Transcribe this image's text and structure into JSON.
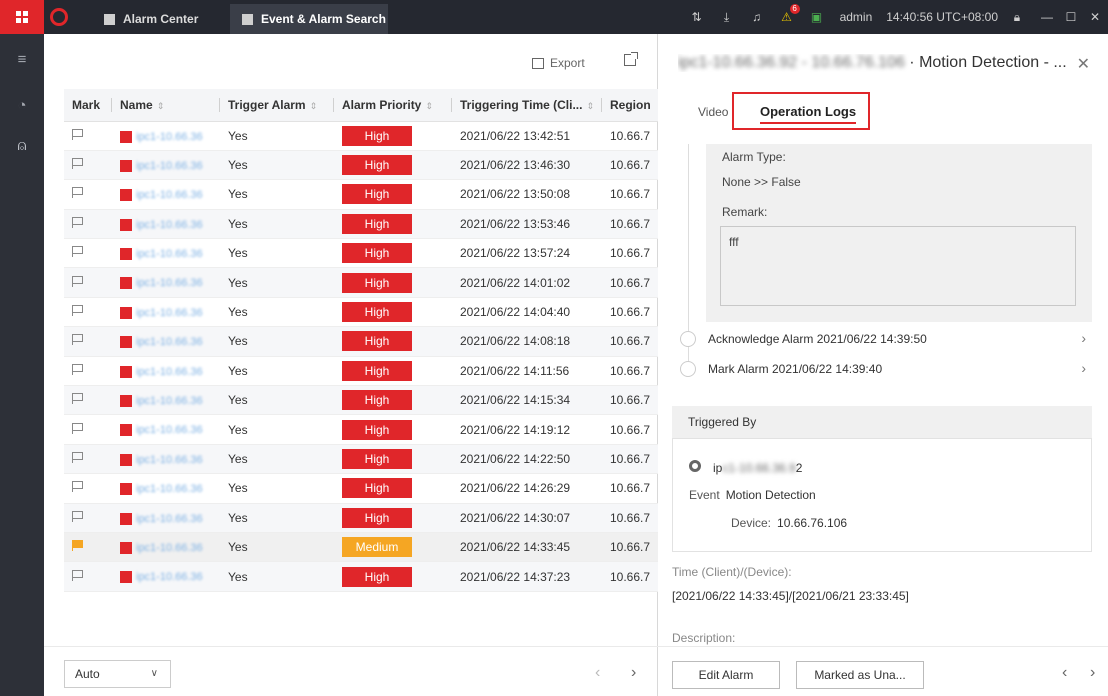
{
  "titlebar": {
    "tabs": [
      {
        "label": "Alarm Center",
        "icon": "alarm-center-icon"
      },
      {
        "label": "Event & Alarm Search",
        "icon": "event-search-icon"
      }
    ],
    "notification_count": "6",
    "user": "admin",
    "clock": "14:40:56 UTC+08:00"
  },
  "toolbar": {
    "export_label": "Export"
  },
  "table": {
    "columns": [
      "Mark",
      "Name",
      "Trigger Alarm",
      "Alarm Priority",
      "Triggering Time (Cli...",
      "Region"
    ],
    "rows": [
      {
        "marked": false,
        "name": "ipc1-10.66.36",
        "trigger": "Yes",
        "priority": "High",
        "time": "2021/06/22 13:42:51",
        "region": "10.66.7"
      },
      {
        "marked": false,
        "name": "ipc1-10.66.36",
        "trigger": "Yes",
        "priority": "High",
        "time": "2021/06/22 13:46:30",
        "region": "10.66.7"
      },
      {
        "marked": false,
        "name": "ipc1-10.66.36",
        "trigger": "Yes",
        "priority": "High",
        "time": "2021/06/22 13:50:08",
        "region": "10.66.7"
      },
      {
        "marked": false,
        "name": "ipc1-10.66.36",
        "trigger": "Yes",
        "priority": "High",
        "time": "2021/06/22 13:53:46",
        "region": "10.66.7"
      },
      {
        "marked": false,
        "name": "ipc1-10.66.36",
        "trigger": "Yes",
        "priority": "High",
        "time": "2021/06/22 13:57:24",
        "region": "10.66.7"
      },
      {
        "marked": false,
        "name": "ipc1-10.66.36",
        "trigger": "Yes",
        "priority": "High",
        "time": "2021/06/22 14:01:02",
        "region": "10.66.7"
      },
      {
        "marked": false,
        "name": "ipc1-10.66.36",
        "trigger": "Yes",
        "priority": "High",
        "time": "2021/06/22 14:04:40",
        "region": "10.66.7"
      },
      {
        "marked": false,
        "name": "ipc1-10.66.36",
        "trigger": "Yes",
        "priority": "High",
        "time": "2021/06/22 14:08:18",
        "region": "10.66.7"
      },
      {
        "marked": false,
        "name": "ipc1-10.66.36",
        "trigger": "Yes",
        "priority": "High",
        "time": "2021/06/22 14:11:56",
        "region": "10.66.7"
      },
      {
        "marked": false,
        "name": "ipc1-10.66.36",
        "trigger": "Yes",
        "priority": "High",
        "time": "2021/06/22 14:15:34",
        "region": "10.66.7"
      },
      {
        "marked": false,
        "name": "ipc1-10.66.36",
        "trigger": "Yes",
        "priority": "High",
        "time": "2021/06/22 14:19:12",
        "region": "10.66.7"
      },
      {
        "marked": false,
        "name": "ipc1-10.66.36",
        "trigger": "Yes",
        "priority": "High",
        "time": "2021/06/22 14:22:50",
        "region": "10.66.7"
      },
      {
        "marked": false,
        "name": "ipc1-10.66.36",
        "trigger": "Yes",
        "priority": "High",
        "time": "2021/06/22 14:26:29",
        "region": "10.66.7"
      },
      {
        "marked": false,
        "name": "ipc1-10.66.36",
        "trigger": "Yes",
        "priority": "High",
        "time": "2021/06/22 14:30:07",
        "region": "10.66.7"
      },
      {
        "marked": true,
        "name": "ipc1-10.66.36",
        "trigger": "Yes",
        "priority": "Medium",
        "time": "2021/06/22 14:33:45",
        "region": "10.66.7"
      },
      {
        "marked": false,
        "name": "ipc1-10.66.36",
        "trigger": "Yes",
        "priority": "High",
        "time": "2021/06/22 14:37:23",
        "region": "10.66.7"
      }
    ]
  },
  "footer": {
    "page_size": "Auto"
  },
  "detail": {
    "title_blurred": "ipc1-10.66.36.92 - 10.66.76.106",
    "title": "· Motion Detection - ...",
    "tabs": {
      "video": "Video",
      "oplogs": "Operation Logs"
    },
    "alarm_type_label": "Alarm Type:",
    "alarm_type_value": "None >> False",
    "remark_label": "Remark:",
    "remark_value": "fff",
    "log_items": [
      {
        "label": "Acknowledge Alarm  2021/06/22 14:39:50"
      },
      {
        "label": "Mark Alarm  2021/06/22 14:39:40"
      }
    ],
    "triggered_by_label": "Triggered By",
    "source_prefix": "ip",
    "source_blurred": "c1-10.66.36.9",
    "source_suffix": "2",
    "event_label": "Event",
    "event_value": "Motion Detection",
    "device_label": "Device:",
    "device_value": "10.66.76.106",
    "time_label": "Time (Client)/(Device):",
    "time_value": "[2021/06/22 14:33:45]/[2021/06/21 23:33:45]",
    "description_label": "Description:",
    "edit_button": "Edit Alarm",
    "marked_button": "Marked as Una..."
  },
  "colors": {
    "accent": "#e0262a",
    "medium": "#f5a623",
    "titlebar": "#252830"
  }
}
